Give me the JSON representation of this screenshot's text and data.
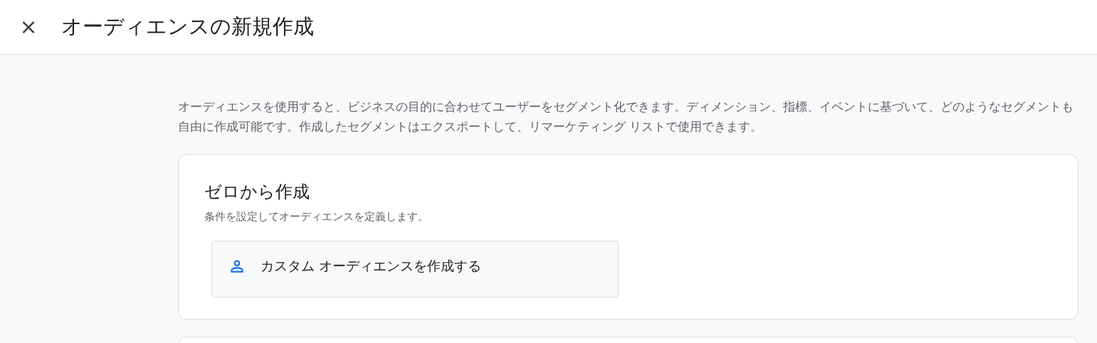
{
  "header": {
    "close_label": "×",
    "title": "オーディエンスの新規作成"
  },
  "description": "オーディエンスを使用すると、ビジネスの目的に合わせてユーザーをセグメント化できます。ディメンション、指標、イベントに基づいて、どのようなセグメントも自由に作成可能です。作成したセグメントはエクスポートして、リマーケティング リストで使用できます。",
  "cards": [
    {
      "kind": "options",
      "title": "ゼロから作成",
      "subtitle": "条件を設定してオーディエンスを定義します。",
      "options": [
        {
          "label": "カスタム オーディエンスを作成する"
        }
      ]
    },
    {
      "kind": "empty"
    }
  ]
}
